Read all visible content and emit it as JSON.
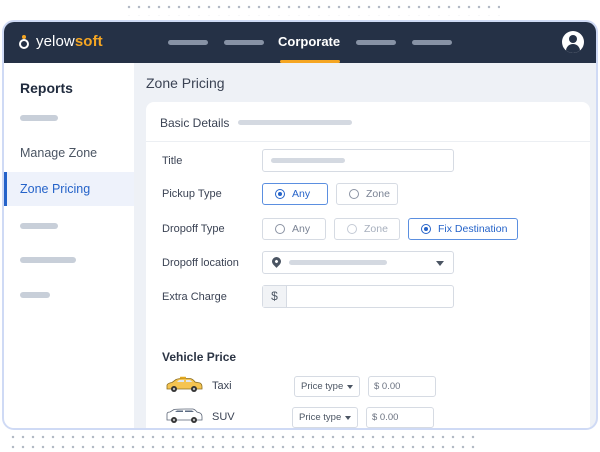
{
  "brand": {
    "name_plain": "yelow",
    "name_accent": "soft"
  },
  "nav": {
    "active_label": "Corporate"
  },
  "sidebar": {
    "title": "Reports",
    "items": [
      {
        "label": "Manage Zone"
      },
      {
        "label": "Zone Pricing",
        "active": true
      }
    ]
  },
  "page": {
    "title": "Zone Pricing"
  },
  "form": {
    "section_title": "Basic Details",
    "title_label": "Title",
    "pickup": {
      "label": "Pickup Type",
      "options": [
        "Any",
        "Zone"
      ],
      "selected": "Any"
    },
    "dropoff": {
      "label": "Dropoff Type",
      "options": [
        "Any",
        "Zone",
        "Fix Destination"
      ],
      "selected": "Fix Destination"
    },
    "dropoff_location_label": "Dropoff location",
    "extra_charge": {
      "label": "Extra Charge",
      "prefix": "$"
    }
  },
  "vehicle_price": {
    "title": "Vehicle Price",
    "rows": [
      {
        "name": "Taxi",
        "select_placeholder": "Price type",
        "price": "$ 0.00"
      },
      {
        "name": "SUV",
        "select_placeholder": "Price type",
        "price": "$ 0.00"
      }
    ]
  },
  "colors": {
    "topbar": "#253146",
    "accent": "#f5a623",
    "primary": "#2563c9",
    "taxi": "#f5c451",
    "suv": "#ffffff"
  }
}
